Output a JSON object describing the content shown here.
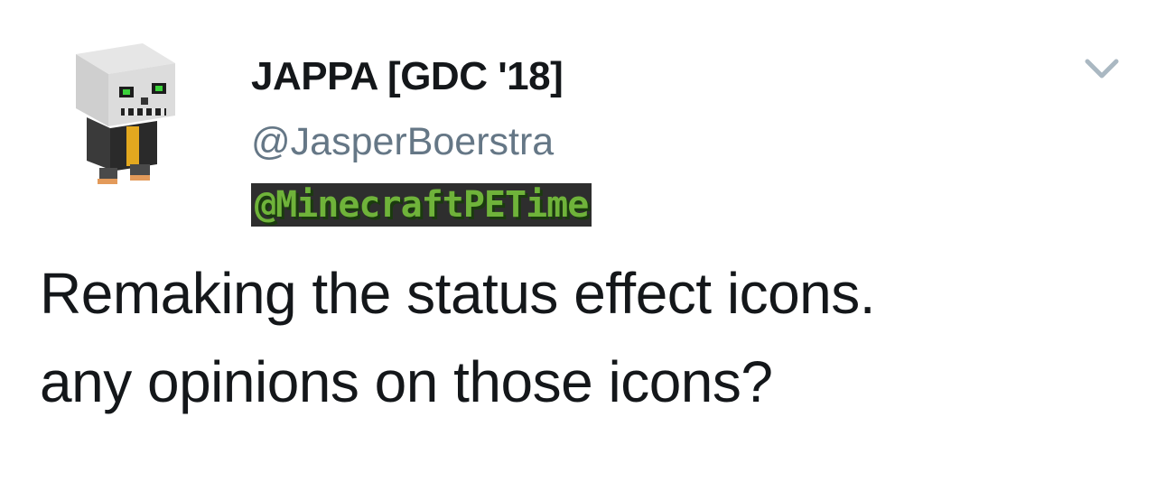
{
  "tweet": {
    "author": {
      "display_name": "JAPPA [GDC '18]",
      "handle": "@JasperBoerstra",
      "avatar_icon": "minecraft-skeleton-avatar"
    },
    "watermark": "@MinecraftPETime",
    "menu_icon": "chevron-down-icon",
    "text_lines": [
      "Remaking the status effect icons.",
      "any opinions on those icons?"
    ]
  },
  "colors": {
    "text": "#14171a",
    "handle": "#657786",
    "chevron": "#aab8c2",
    "watermark_green": "#6fb33a"
  }
}
